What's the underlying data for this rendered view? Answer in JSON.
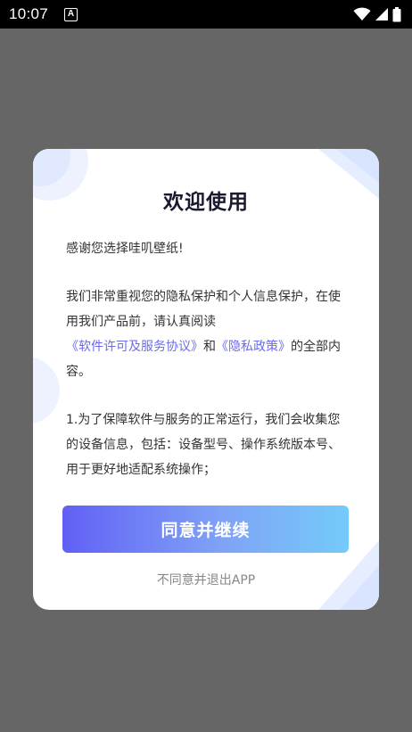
{
  "status_bar": {
    "time": "10:07",
    "notification_badge": "A",
    "icons": [
      "wifi-icon",
      "signal-icon",
      "battery-icon"
    ]
  },
  "dialog": {
    "title": "欢迎使用",
    "greeting": "感谢您选择哇叽壁纸!",
    "privacy_text_prefix": "我们非常重视您的隐私保护和个人信息保护，在使用我们产品前，请认真阅读",
    "license_link": "《软件许可及服务协议》",
    "conjunction": "和",
    "privacy_link": "《隐私政策》",
    "privacy_text_suffix": "的全部内容。",
    "collection_notice": "1.为了保障软件与服务的正常运行，我们会收集您的设备信息，包括：设备型号、操作系统版本号、用于更好地适配系统操作；",
    "agree_button_label": "同意并继续",
    "decline_label": "不同意并退出APP"
  },
  "colors": {
    "overlay": "#666666",
    "link": "#6b6bea",
    "button_gradient_start": "#6160f5",
    "button_gradient_end": "#74cbf9"
  }
}
